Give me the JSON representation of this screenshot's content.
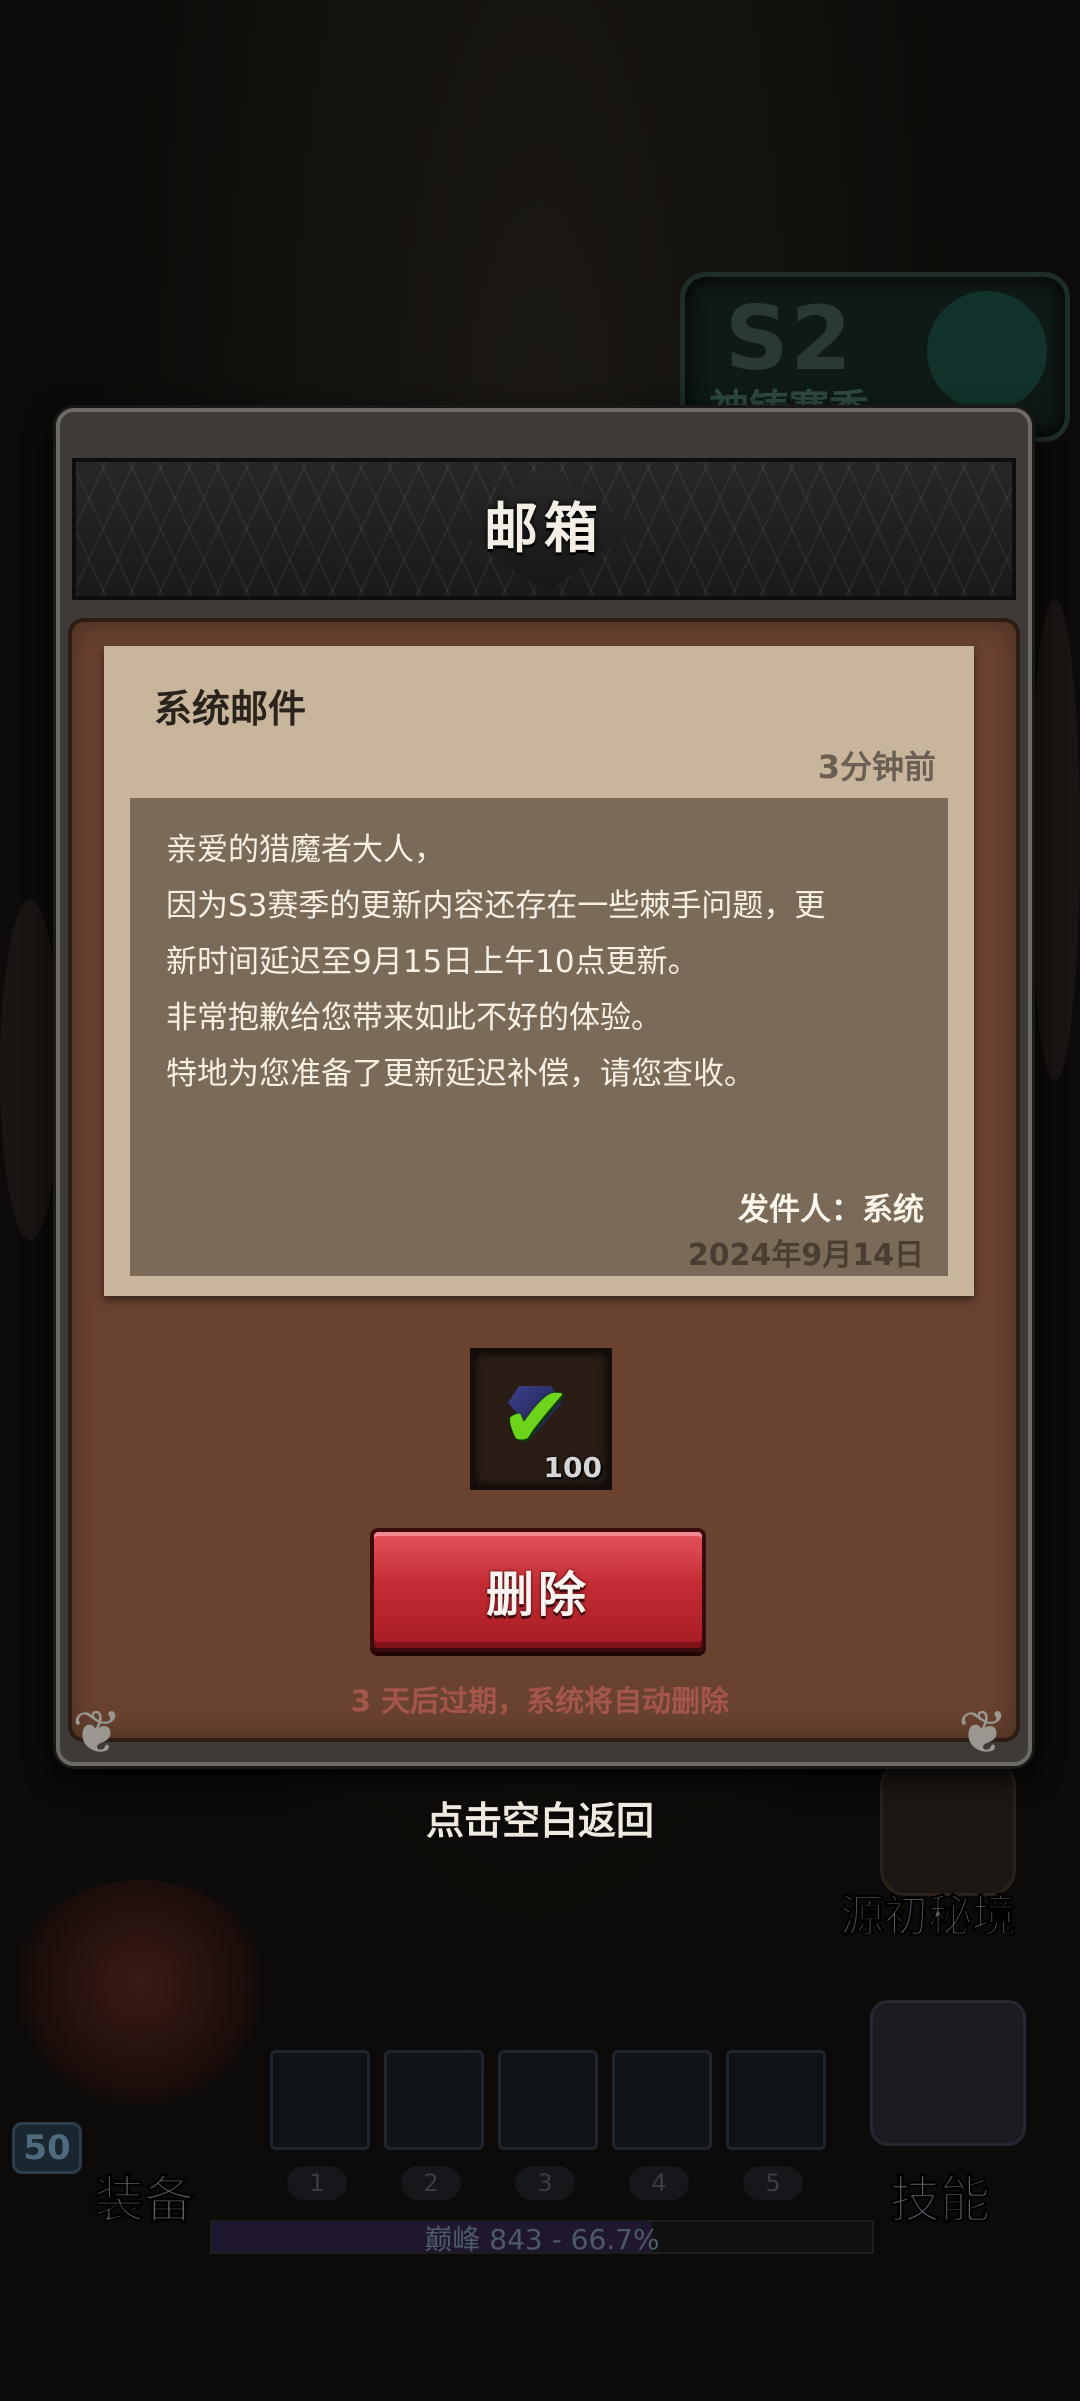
{
  "background": {
    "season_badge": {
      "big": "S2",
      "sub": "神铸赛季"
    },
    "secret_realm_label": "源初秘境",
    "level": "50",
    "equip_label": "装备",
    "skill_label": "技能",
    "slot_numbers": [
      "1",
      "2",
      "3",
      "4",
      "5"
    ],
    "peak": {
      "label": "巅峰 843 - 66.7%",
      "progress_percent": 66.7
    }
  },
  "mailbox": {
    "title": "邮箱",
    "mail": {
      "sender_title": "系统邮件",
      "time_ago": "3分钟前",
      "lines": [
        "亲爱的猎魔者大人，",
        "因为S3赛季的更新内容还存在一些棘手问题，更",
        "新时间延迟至9月15日上午10点更新。",
        "非常抱歉给您带来如此不好的体验。",
        "特地为您准备了更新延迟补偿，请您查收。"
      ],
      "signer": "发件人：系统",
      "date": "2024年9月14日"
    },
    "reward": {
      "icon": "gem-claimed-check-icon",
      "quantity": "100"
    },
    "delete_label": "删除",
    "expire_note": "3 天后过期，系统将自动删除"
  },
  "return_hint": "点击空白返回",
  "colors": {
    "delete_button": "#c42c34",
    "expire_note": "#a4564a",
    "letter_paper": "#c8b59b",
    "panel_brown": "#6a4330"
  }
}
